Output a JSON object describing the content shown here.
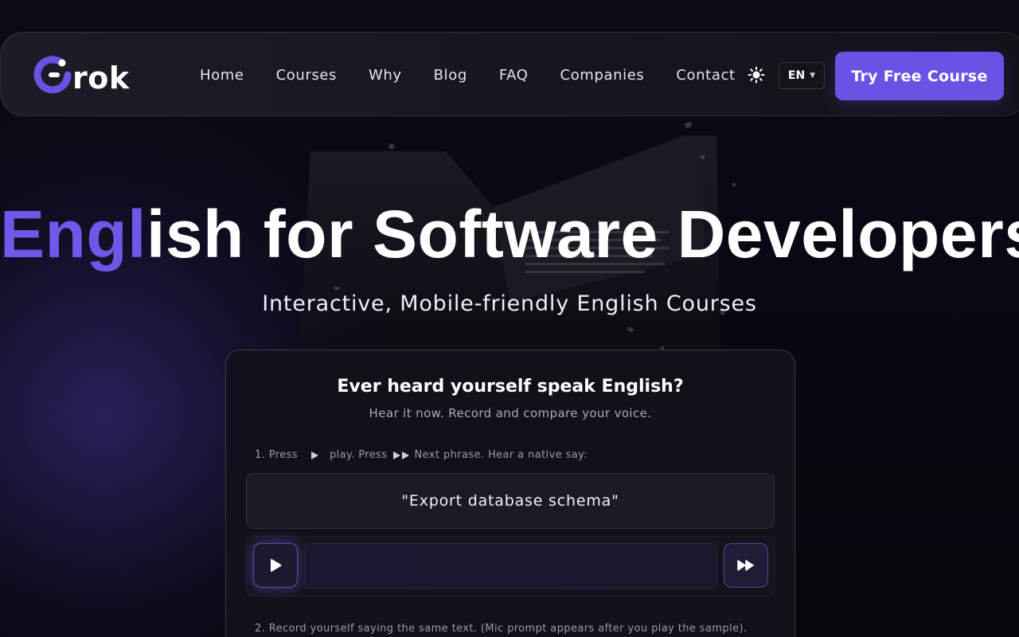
{
  "brand": {
    "logo_text": "rok",
    "accent_color": "#6a52e4"
  },
  "nav": {
    "links": [
      "Home",
      "Courses",
      "Why",
      "Blog",
      "FAQ",
      "Companies",
      "Contact"
    ],
    "theme_icon": "sun-icon",
    "language": "EN",
    "cta_label": "Try Free Course"
  },
  "hero": {
    "title_accent": "Engl",
    "title_rest": "ish for Software Developers",
    "subtitle": "Interactive, Mobile-friendly English Courses"
  },
  "practice": {
    "title": "Ever heard yourself speak English?",
    "subtitle": "Hear it now. Record and compare your voice.",
    "step1_prefix": "1. Press",
    "step1_middle": "play. Press",
    "step1_suffix": "Next phrase. Hear a native say:",
    "phrase": "\"Export database schema\"",
    "play_icon": "play-icon",
    "next_icon": "fast-forward-icon",
    "step2": "2. Record yourself saying the same text. (Mic prompt appears after you play the sample)."
  }
}
